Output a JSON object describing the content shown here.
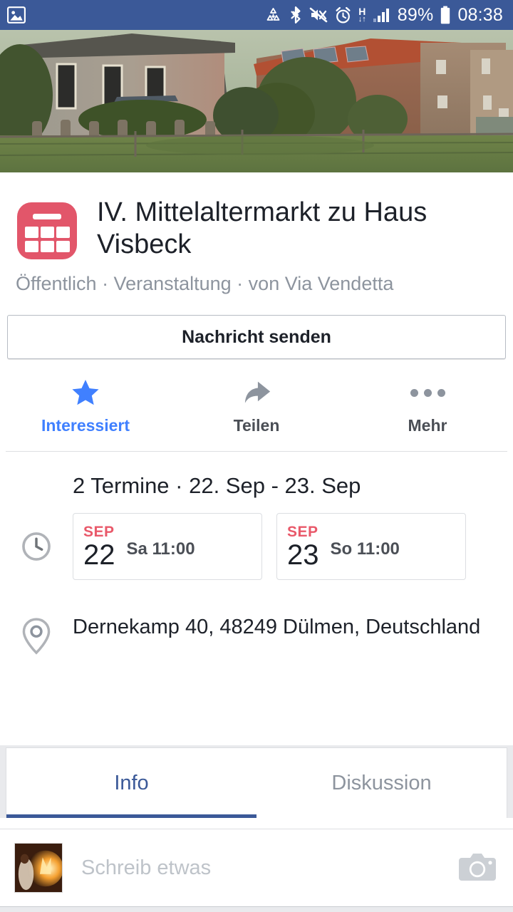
{
  "statusbar": {
    "left_icons": [
      {
        "name": "photo-notification-icon",
        "glyph": "image"
      }
    ],
    "right_icons": [
      {
        "name": "data-saver-icon",
        "glyph": "recycle"
      },
      {
        "name": "bluetooth-icon",
        "glyph": "bluetooth"
      },
      {
        "name": "mute-icon",
        "glyph": "speaker-muted"
      },
      {
        "name": "alarm-icon",
        "glyph": "alarm-clock"
      }
    ],
    "network_type": "H",
    "network_arrows": "↓↑",
    "signal": "signal-bars-icon",
    "battery_percent": "89%",
    "time": "08:38",
    "background_color": "#3b5998",
    "foreground_color": "#ffffff"
  },
  "cover": {
    "name": "event-cover-photo",
    "alt": "Historic brick farmhouse buildings with grass meadow in foreground"
  },
  "event": {
    "icon_name": "calendar-event-icon",
    "icon_color": "#e2566a",
    "title": "IV. Mittelaltermarkt zu Haus Visbeck",
    "subtitle": "Öffentlich · Veranstaltung · von Via Vendetta",
    "privacy": "Öffentlich",
    "type": "Veranstaltung",
    "host": "von Via Vendetta"
  },
  "primary_button": {
    "label": "Nachricht senden"
  },
  "actions": [
    {
      "label": "Interessiert",
      "icon": "star-icon",
      "active": true,
      "color": "#4080ff"
    },
    {
      "label": "Teilen",
      "icon": "share-arrow-icon",
      "active": false,
      "color": "#8d949e"
    },
    {
      "label": "Mehr",
      "icon": "more-dots-icon",
      "active": false,
      "color": "#8d949e"
    }
  ],
  "dates": {
    "icon": "clock-icon",
    "heading": "2 Termine · 22. Sep - 23. Sep",
    "count_label": "2 Termine",
    "range_label": "22. Sep - 23. Sep",
    "cards": [
      {
        "month": "SEP",
        "day": "22",
        "when": "Sa 11:00"
      },
      {
        "month": "SEP",
        "day": "23",
        "when": "So 11:00"
      }
    ]
  },
  "location": {
    "icon": "map-pin-icon",
    "address": "Dernekamp 40, 48249 Dülmen, Deutschland",
    "line1": "Dernekamp 40, 48249 Dülmen,",
    "line2": "Deutschland"
  },
  "tabs": [
    {
      "label": "Info",
      "active": true
    },
    {
      "label": "Diskussion",
      "active": false
    }
  ],
  "composer": {
    "avatar_name": "user-avatar",
    "placeholder": "Schreib etwas",
    "camera_icon": "camera-icon"
  },
  "theme": {
    "brand_blue": "#3b5998",
    "link_blue": "#4080ff",
    "accent_red": "#e9596a",
    "text_primary": "#1d2129",
    "text_secondary": "#8d949e",
    "divider": "#dddfe2"
  }
}
